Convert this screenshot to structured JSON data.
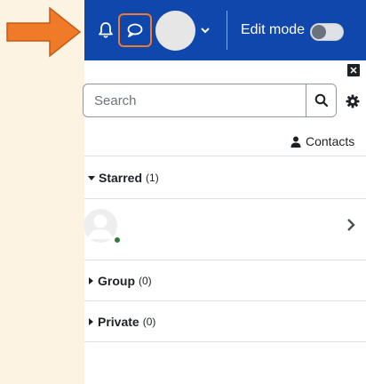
{
  "navbar": {
    "edit_mode_label": "Edit mode",
    "edit_mode_on": false,
    "brand_color": "#0f47ad",
    "highlight_color": "#f07a2d"
  },
  "drawer": {
    "search": {
      "placeholder": "Search",
      "value": ""
    },
    "contacts_label": "Contacts",
    "sections": [
      {
        "name": "Starred",
        "count": "(1)",
        "expanded": true
      },
      {
        "name": "Group",
        "count": "(0)",
        "expanded": false
      },
      {
        "name": "Private",
        "count": "(0)",
        "expanded": false
      }
    ],
    "starred_contact": {
      "online": true
    }
  },
  "icons": {
    "notifications": "bell-icon",
    "messages": "chat-bubble-icon",
    "user_menu": "chevron-down-icon",
    "close": "close-icon",
    "search": "search-icon",
    "settings": "gear-icon",
    "contacts": "user-icon",
    "open_conversation": "chevron-right-icon",
    "pointer": "arrow-right-icon"
  }
}
